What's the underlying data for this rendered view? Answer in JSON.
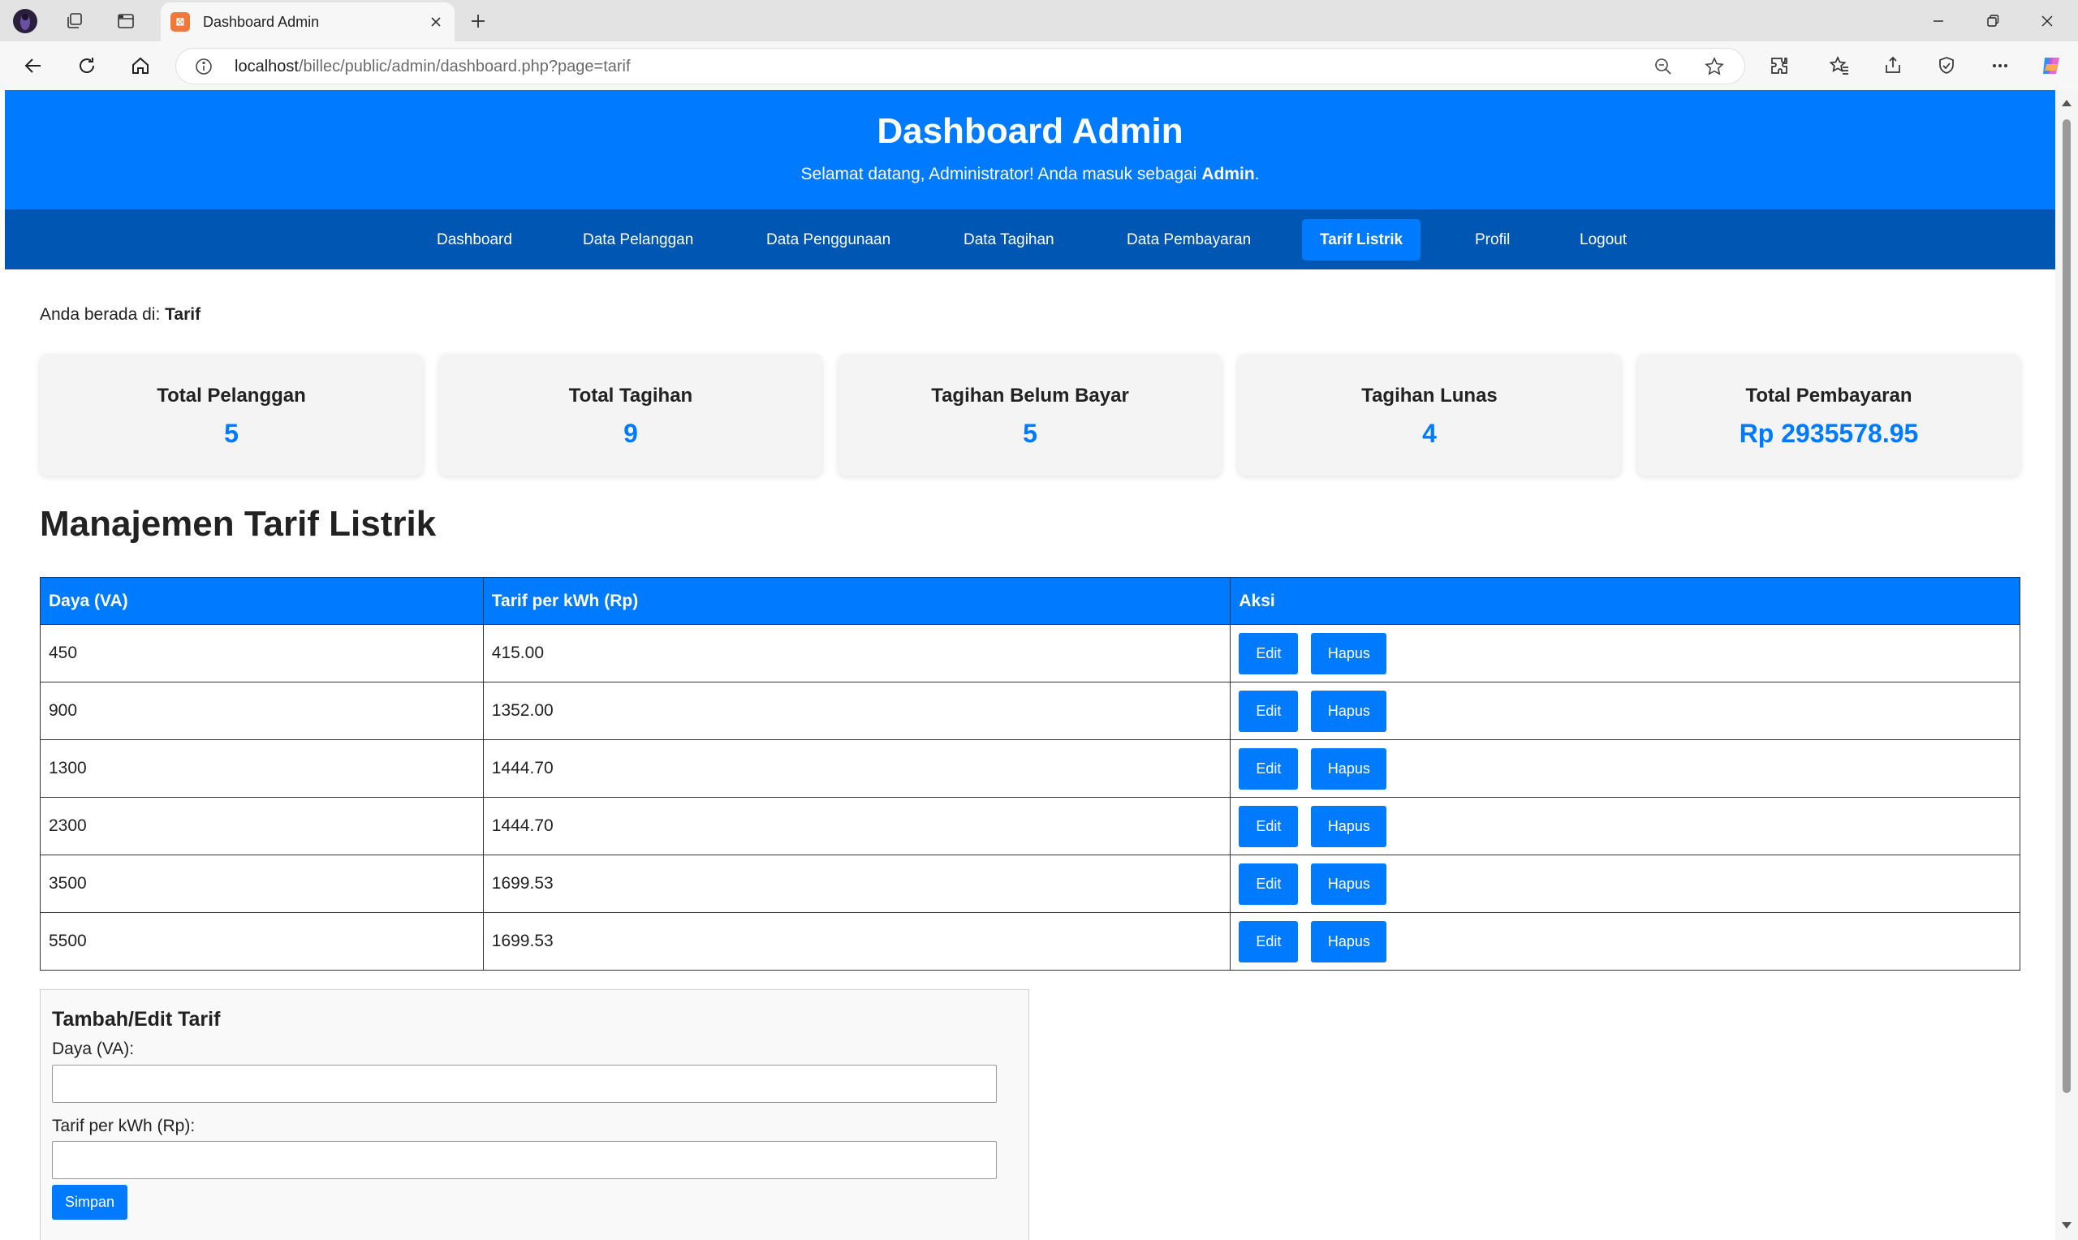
{
  "browser": {
    "tab_title": "Dashboard Admin",
    "url_host": "localhost",
    "url_path": "/billec/public/admin/dashboard.php?page=tarif"
  },
  "header": {
    "title": "Dashboard Admin",
    "welcome_prefix": "Selamat datang, Administrator! Anda masuk sebagai ",
    "role": "Admin",
    "welcome_suffix": "."
  },
  "nav": {
    "items": [
      {
        "label": "Dashboard"
      },
      {
        "label": "Data Pelanggan"
      },
      {
        "label": "Data Penggunaan"
      },
      {
        "label": "Data Tagihan"
      },
      {
        "label": "Data Pembayaran"
      },
      {
        "label": "Tarif Listrik"
      },
      {
        "label": "Profil"
      },
      {
        "label": "Logout"
      }
    ],
    "active": "Tarif Listrik"
  },
  "breadcrumb": {
    "prefix": "Anda berada di: ",
    "current": "Tarif"
  },
  "stats": [
    {
      "label": "Total Pelanggan",
      "value": "5"
    },
    {
      "label": "Total Tagihan",
      "value": "9"
    },
    {
      "label": "Tagihan Belum Bayar",
      "value": "5"
    },
    {
      "label": "Tagihan Lunas",
      "value": "4"
    },
    {
      "label": "Total Pembayaran",
      "value": "Rp 2935578.95"
    }
  ],
  "section": {
    "title": "Manajemen Tarif Listrik"
  },
  "table": {
    "headers": [
      "Daya (VA)",
      "Tarif per kWh (Rp)",
      "Aksi"
    ],
    "edit_label": "Edit",
    "delete_label": "Hapus",
    "rows": [
      {
        "daya": "450",
        "tarif": "415.00"
      },
      {
        "daya": "900",
        "tarif": "1352.00"
      },
      {
        "daya": "1300",
        "tarif": "1444.70"
      },
      {
        "daya": "2300",
        "tarif": "1444.70"
      },
      {
        "daya": "3500",
        "tarif": "1699.53"
      },
      {
        "daya": "5500",
        "tarif": "1699.53"
      }
    ]
  },
  "form": {
    "title": "Tambah/Edit Tarif",
    "daya_label": "Daya (VA):",
    "daya_value": "",
    "tarif_label": "Tarif per kWh (Rp):",
    "tarif_value": "",
    "submit_label": "Simpan"
  },
  "colors": {
    "primary": "#007bff",
    "nav": "#0056b3"
  }
}
